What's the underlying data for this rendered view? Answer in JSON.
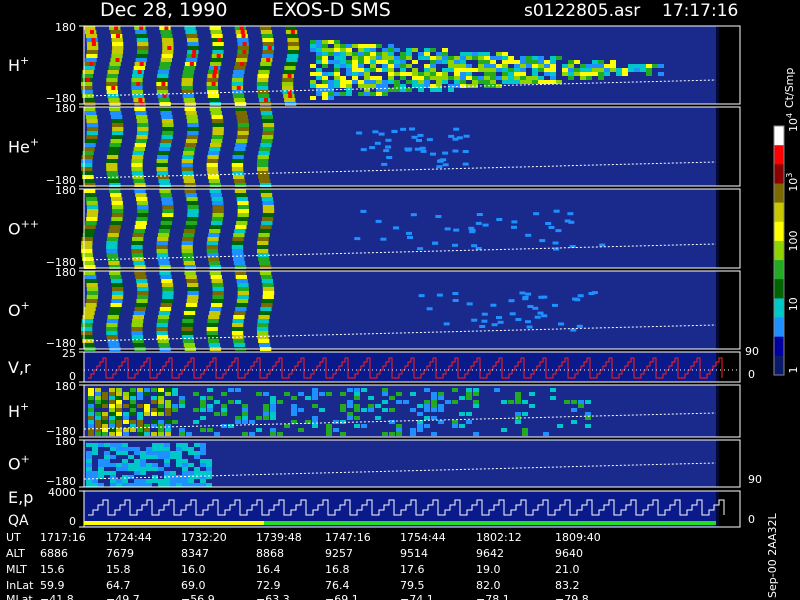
{
  "header": {
    "date": "Dec 28, 1990",
    "instrument": "EXOS-D SMS",
    "file": "s0122805.asr",
    "time": "17:17:16"
  },
  "colorbar": {
    "unit": "Ct/Smp",
    "ticks": [
      {
        "label": "10",
        "sup": "4",
        "frac": 1.0
      },
      {
        "label": "10",
        "sup": "3",
        "frac": 0.76
      },
      {
        "label": "100",
        "sup": "",
        "frac": 0.52
      },
      {
        "label": "10",
        "sup": "",
        "frac": 0.28
      },
      {
        "label": "1",
        "sup": "",
        "frac": 0.03
      }
    ],
    "colors": [
      "#ffffff",
      "#ff0000",
      "#8b0000",
      "#7a6a00",
      "#c8c800",
      "#ffff00",
      "#8fd400",
      "#22aa22",
      "#006400",
      "#00c8c8",
      "#1e90ff",
      "#0000a0",
      "#0a1a6a"
    ]
  },
  "panels": [
    {
      "id": "h-plus",
      "label": "H",
      "sup": "+",
      "ymax": "180",
      "ymin": "−180"
    },
    {
      "id": "he-plus",
      "label": "He",
      "sup": "+",
      "ymax": "180",
      "ymin": "−180"
    },
    {
      "id": "o-plusplus",
      "label": "O",
      "sup": "++",
      "ymax": "180",
      "ymin": "−180"
    },
    {
      "id": "o-plus",
      "label": "O",
      "sup": "+",
      "ymax": "180",
      "ymin": "−180"
    },
    {
      "id": "vr",
      "label": "V,r",
      "sup": "",
      "ymax": "25",
      "ymin": "0",
      "right_top": "90",
      "right_bottom": "0"
    },
    {
      "id": "h-plus-2",
      "label": "H",
      "sup": "+",
      "ymax": "180",
      "ymin": "−180"
    },
    {
      "id": "o-plus-2",
      "label": "O",
      "sup": "+",
      "ymax": "180",
      "ymin": "−180",
      "right_bottom": "90"
    },
    {
      "id": "ep",
      "label": "E,p",
      "sup": "",
      "label2": "QA",
      "ymax": "4000",
      "ymin": "0",
      "right_bottom": "0"
    }
  ],
  "ephemeris": {
    "rows": [
      {
        "name": "UT",
        "values": [
          "1717:16",
          "1724:44",
          "1732:20",
          "1739:48",
          "1747:16",
          "1754:44",
          "1802:12",
          "1809:40"
        ]
      },
      {
        "name": "ALT",
        "values": [
          "6886",
          "7679",
          "8347",
          "8868",
          "9257",
          "9514",
          "9642",
          "9640"
        ]
      },
      {
        "name": "MLT",
        "values": [
          "15.6",
          "15.8",
          "16.0",
          "16.4",
          "16.8",
          "17.6",
          "19.0",
          "21.0"
        ]
      },
      {
        "name": "InLat",
        "values": [
          "59.9",
          "64.7",
          "69.0",
          "72.9",
          "76.4",
          "79.5",
          "82.0",
          "83.2"
        ]
      },
      {
        "name": "MLat",
        "values": [
          "−41.8",
          "−49.7",
          "−56.9",
          "−63.3",
          "−69.1",
          "−74.1",
          "−78.1",
          "−79.8"
        ]
      }
    ]
  },
  "footer": {
    "stamp": "Sep-00 2AA32L"
  },
  "chart_data": {
    "type": "heatmap",
    "title": "Dec 28, 1990   EXOS-D SMS",
    "x": [
      "1717:16",
      "1724:44",
      "1732:20",
      "1739:48",
      "1747:16",
      "1754:44",
      "1802:12",
      "1809:40"
    ],
    "series": [
      {
        "name": "H+",
        "ylim": [
          -180,
          180
        ]
      },
      {
        "name": "He+",
        "ylim": [
          -180,
          180
        ]
      },
      {
        "name": "O++",
        "ylim": [
          -180,
          180
        ]
      },
      {
        "name": "O+",
        "ylim": [
          -180,
          180
        ]
      },
      {
        "name": "V,r",
        "ylim": [
          0,
          25
        ]
      },
      {
        "name": "H+",
        "ylim": [
          -180,
          180
        ]
      },
      {
        "name": "O+",
        "ylim": [
          -180,
          180
        ]
      },
      {
        "name": "E,p",
        "ylim": [
          0,
          4000
        ]
      }
    ],
    "color_scale": {
      "unit": "Ct/Smp",
      "range": [
        1,
        10000
      ],
      "log": true
    }
  }
}
